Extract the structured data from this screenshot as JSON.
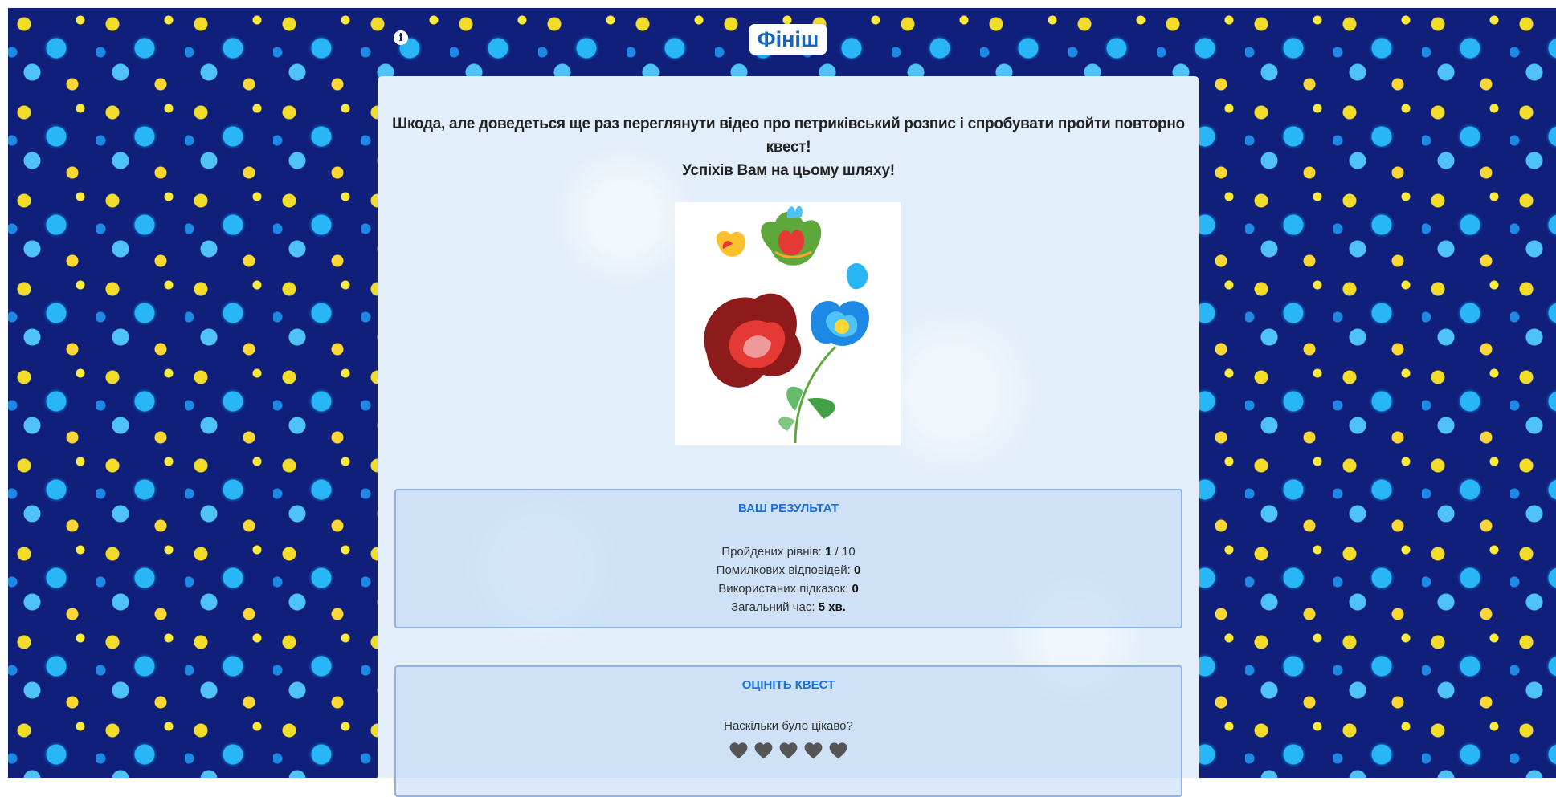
{
  "header": {
    "title": "Фініш",
    "info_icon": "info-icon"
  },
  "message": {
    "line1": "Шкода, але доведеться ще раз переглянути відео про петриківський розпис і спробувати пройти повторно квест!",
    "line2": "Успіхів Вам на цьому шляху!"
  },
  "image": {
    "icon": "petrykivka-flower-illustration"
  },
  "result": {
    "title": "ВАШ РЕЗУЛЬТАТ",
    "levels_label": "Пройдених рівнів:",
    "levels_value": "1",
    "levels_total": " / 10",
    "errors_label": "Помилкових відповідей:",
    "errors_value": "0",
    "hints_label": "Використаних підказок:",
    "hints_value": "0",
    "time_label": "Загальний час:",
    "time_value": "5 хв."
  },
  "rating": {
    "title": "ОЦІНІТЬ КВЕСТ",
    "question": "Наскільки було цікаво?",
    "hearts_count": 5,
    "heart_icon": "heart-icon"
  },
  "colors": {
    "accent": "#1e6fd9",
    "title_text": "#1565c0",
    "background_pattern": "#10207a"
  }
}
